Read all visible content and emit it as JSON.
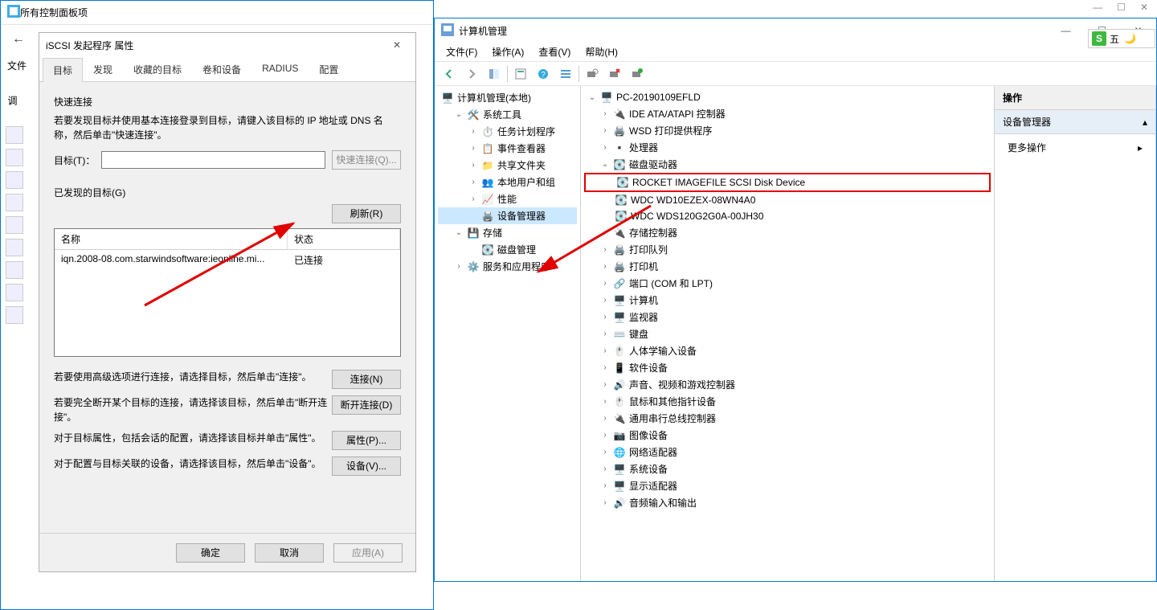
{
  "cp": {
    "title": "所有控制面板项",
    "file_menu": "文件",
    "adjust": "调"
  },
  "ime": {
    "label": "五"
  },
  "dialog": {
    "title": "iSCSI 发起程序 属性",
    "tabs": [
      "目标",
      "发现",
      "收藏的目标",
      "卷和设备",
      "RADIUS",
      "配置"
    ],
    "quick_connect_header": "快速连接",
    "quick_desc": "若要发现目标并使用基本连接登录到目标，请键入该目标的 IP 地址或 DNS 名称，然后单击\"快速连接\"。",
    "target_label": "目标(T)：",
    "quick_connect_btn": "快速连接(Q)...",
    "discovered_header": "已发现的目标(G)",
    "refresh_btn": "刷新(R)",
    "col_name": "名称",
    "col_status": "状态",
    "row_name": "iqn.2008-08.com.starwindsoftware:ieonline.mi...",
    "row_status": "已连接",
    "sec1_text": "若要使用高级选项进行连接，请选择目标，然后单击\"连接\"。",
    "sec1_btn": "连接(N)",
    "sec2_text": "若要完全断开某个目标的连接，请选择该目标，然后单击\"断开连接\"。",
    "sec2_btn": "断开连接(D)",
    "sec3_text": "对于目标属性，包括会话的配置，请选择该目标并单击\"属性\"。",
    "sec3_btn": "属性(P)...",
    "sec4_text": "对于配置与目标关联的设备，请选择该目标，然后单击\"设备\"。",
    "sec4_btn": "设备(V)...",
    "ok": "确定",
    "cancel": "取消",
    "apply": "应用(A)"
  },
  "cm": {
    "title": "计算机管理",
    "menus": [
      "文件(F)",
      "操作(A)",
      "查看(V)",
      "帮助(H)"
    ],
    "left_tree": {
      "root": "计算机管理(本地)",
      "sys_tools": "系统工具",
      "task_sched": "任务计划程序",
      "event_viewer": "事件查看器",
      "shared_folders": "共享文件夹",
      "local_users": "本地用户和组",
      "perf": "性能",
      "dev_mgr": "设备管理器",
      "storage": "存储",
      "disk_mgmt": "磁盘管理",
      "services": "服务和应用程序"
    },
    "devtree": {
      "pc": "PC-20190109EFLD",
      "ide": "IDE ATA/ATAPI 控制器",
      "wsd": "WSD 打印提供程序",
      "cpu": "处理器",
      "disk_drives": "磁盘驱动器",
      "disk1": "ROCKET IMAGEFILE SCSI Disk Device",
      "disk2": "WDC WD10EZEX-08WN4A0",
      "disk3": "WDC WDS120G2G0A-00JH30",
      "storage_ctrl": "存储控制器",
      "print_queue": "打印队列",
      "printer": "打印机",
      "ports": "端口 (COM 和 LPT)",
      "computer": "计算机",
      "monitor": "监视器",
      "keyboard": "键盘",
      "hid": "人体学输入设备",
      "soft_dev": "软件设备",
      "sound": "声音、视频和游戏控制器",
      "mouse": "鼠标和其他指针设备",
      "usb": "通用串行总线控制器",
      "imaging": "图像设备",
      "network": "网络适配器",
      "sys_dev": "系统设备",
      "display": "显示适配器",
      "audio_io": "音频输入和输出"
    },
    "actions": {
      "header": "操作",
      "sub": "设备管理器",
      "more": "更多操作"
    }
  }
}
